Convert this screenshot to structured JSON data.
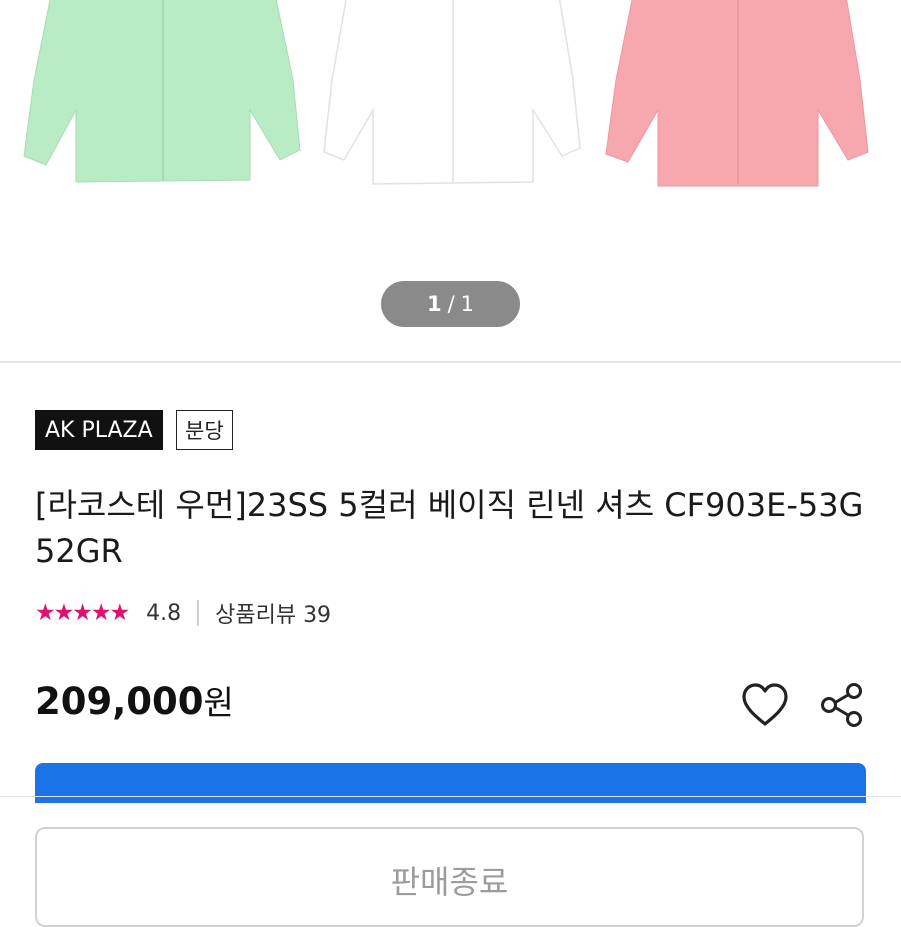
{
  "gallery": {
    "pager_current": "1",
    "pager_separator": "/",
    "pager_total": "1",
    "shirt_colors": [
      "#b8ecc6",
      "#ffffff",
      "#f7a8ae"
    ]
  },
  "seller": {
    "store_badge": "AK PLAZA",
    "branch_badge": "분당"
  },
  "product": {
    "title": "[라코스테 우먼]23SS 5컬러 베이직 린넨 셔츠 CF903E-53G 52GR",
    "stars": "★★★★★",
    "rating": "4.8",
    "review_label": "상품리뷰 39",
    "price": "209,000",
    "currency": "원"
  },
  "actions": {
    "like_icon": "heart-outline-icon",
    "share_icon": "share-icon",
    "soldout_label": "판매종료"
  },
  "colors": {
    "rating_star": "#e0106f",
    "buy_button": "#1a73e8",
    "pager_bg": "#8a8a8a"
  }
}
